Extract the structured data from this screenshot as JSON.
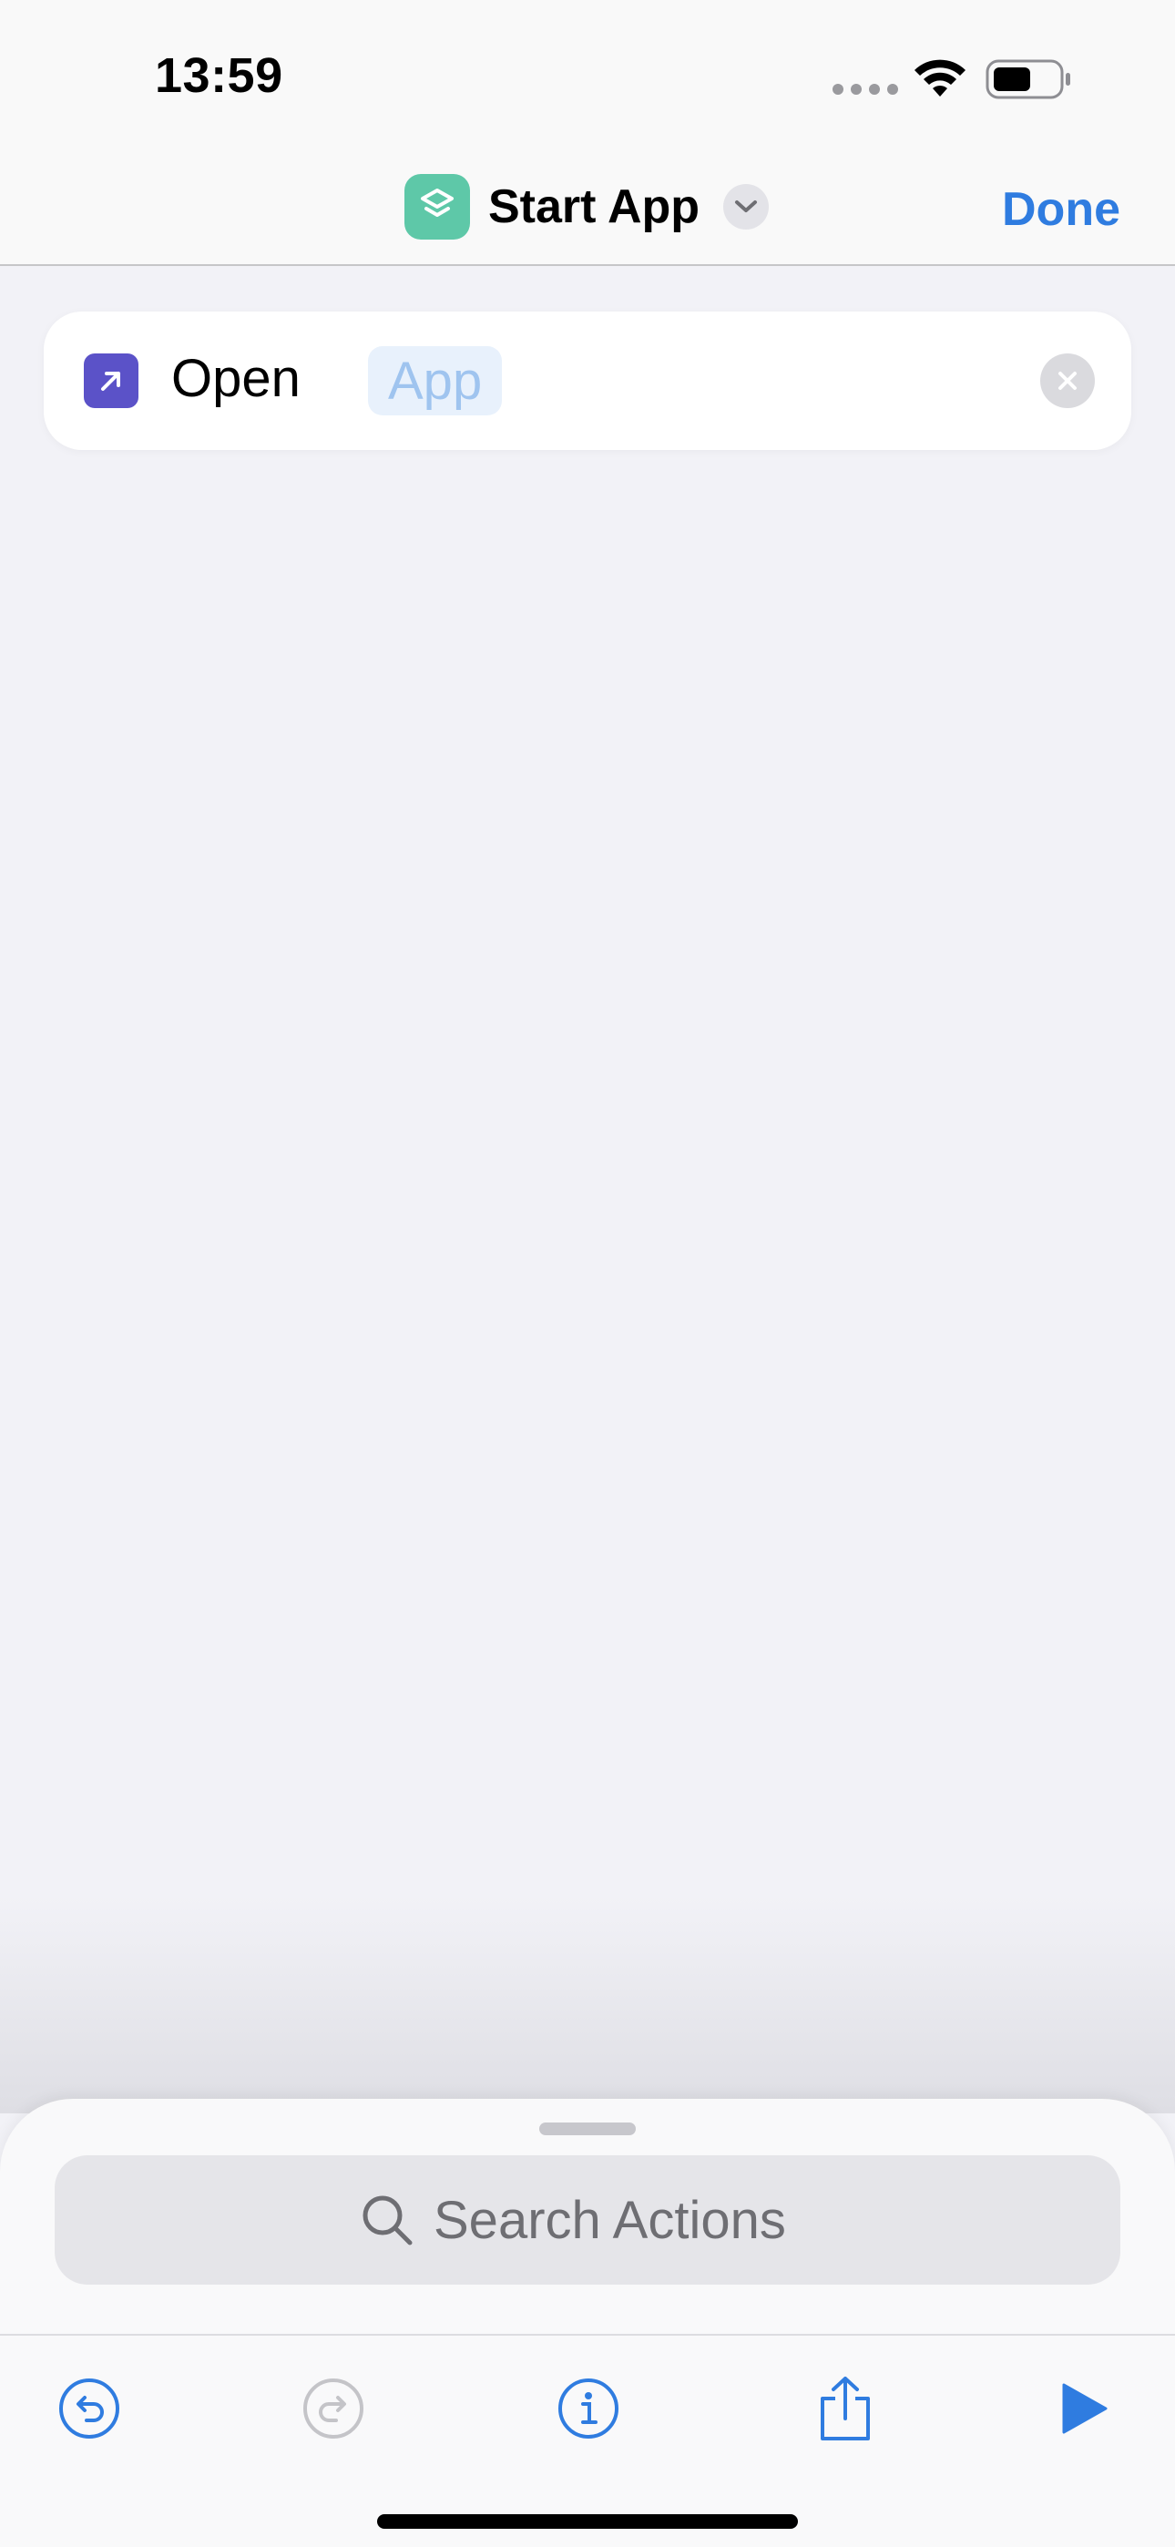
{
  "status_bar": {
    "time": "13:59"
  },
  "nav": {
    "title": "Start App",
    "done_label": "Done",
    "icon_color": "#5ec8a8",
    "accent_color": "#2f7ce0"
  },
  "action": {
    "label": "Open",
    "parameter_placeholder": "App",
    "icon": "arrow-up-right-icon",
    "icon_color": "#5b52c8"
  },
  "search": {
    "placeholder": "Search Actions"
  },
  "toolbar": {
    "items": [
      {
        "icon": "undo-icon",
        "enabled": true
      },
      {
        "icon": "redo-icon",
        "enabled": false
      },
      {
        "icon": "info-icon",
        "enabled": true
      },
      {
        "icon": "share-icon",
        "enabled": true
      },
      {
        "icon": "play-icon",
        "enabled": true
      }
    ]
  }
}
